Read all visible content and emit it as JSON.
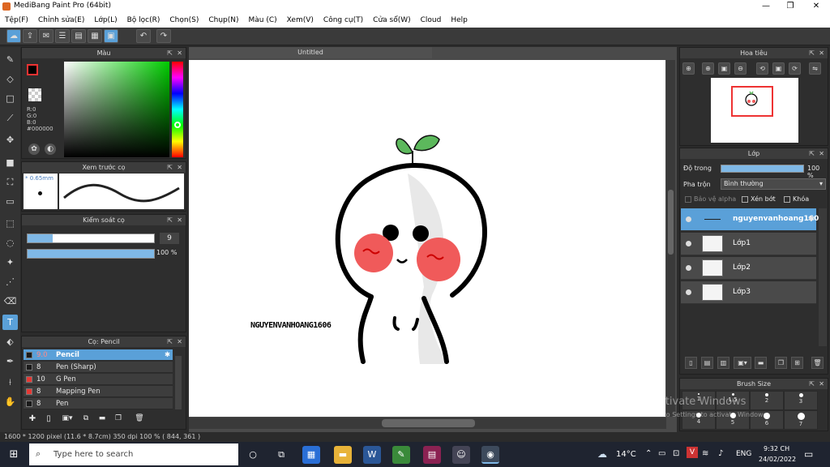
{
  "window": {
    "title": "MediBang Paint Pro (64bit)",
    "minimize": "—",
    "restore": "❐",
    "close": "✕"
  },
  "menu": [
    "Tệp(F)",
    "Chỉnh sửa(E)",
    "Lớp(L)",
    "Bộ lọc(R)",
    "Chọn(S)",
    "Chụp(N)",
    "Màu (C)",
    "Xem(V)",
    "Công cụ(T)",
    "Cửa sổ(W)",
    "Cloud",
    "Help"
  ],
  "color_panel": {
    "title": "Màu",
    "r": "R:0",
    "g": "G:0",
    "b": "B:0",
    "hex": "#000000"
  },
  "brush_preview": {
    "title": "Xem trước cọ",
    "size": "* 0.65mm"
  },
  "brush_control": {
    "title": "Kiểm soát cọ",
    "size_value": "9",
    "opacity_value": "100 %",
    "size_fraction": 0.2,
    "opacity_fraction": 1.0
  },
  "brush_list": {
    "title": "Cọ: Pencil",
    "items": [
      {
        "size": "9.0",
        "name": "Pencil",
        "color": "#1a1a1a",
        "selected": true
      },
      {
        "size": "8",
        "name": "Pen (Sharp)",
        "color": "#1a1a1a",
        "selected": false
      },
      {
        "size": "10",
        "name": "G Pen",
        "color": "#e53935",
        "selected": false
      },
      {
        "size": "8",
        "name": "Mapping Pen",
        "color": "#e53935",
        "selected": false
      },
      {
        "size": "8",
        "name": "Pen",
        "color": "#1a1a1a",
        "selected": false
      }
    ]
  },
  "document": {
    "tab": "Untitled",
    "signature": "NGUYENVANHOANG1606"
  },
  "navigator": {
    "title": "Hoa tiêu"
  },
  "layer_panel": {
    "title": "Lớp",
    "opacity_label": "Độ trong",
    "opacity_value": "100 %",
    "blend_label": "Pha trộn",
    "blend_value": "Bình thường",
    "protect_alpha": "Bảo vệ alpha",
    "clip": "Xén bớt",
    "lock": "Khóa",
    "layers": [
      {
        "name": "nguyenvanhoang1606",
        "selected": true
      },
      {
        "name": "Lớp1",
        "selected": false
      },
      {
        "name": "Lớp2",
        "selected": false
      },
      {
        "name": "Lớp3",
        "selected": false
      }
    ]
  },
  "brush_size_panel": {
    "title": "Brush Size",
    "values": [
      "1",
      "1.5",
      "2",
      "3",
      "4",
      "5",
      "6",
      "7"
    ]
  },
  "watermark": {
    "line1": "Activate Windows",
    "line2": "Go to Settings to activate Windows."
  },
  "status": {
    "text": "1600 * 1200 pixel   (11.6 * 8.7cm)   350 dpi   100 %   ( 844, 361 )"
  },
  "taskbar": {
    "search_placeholder": "Type here to search",
    "weather": "14°C",
    "lang": "ENG",
    "time": "9:32 CH",
    "date": "24/02/2022"
  },
  "colors": {
    "accent": "#5aa0d8",
    "blush": "#f05a5a",
    "sprout": "#5cb85c"
  }
}
